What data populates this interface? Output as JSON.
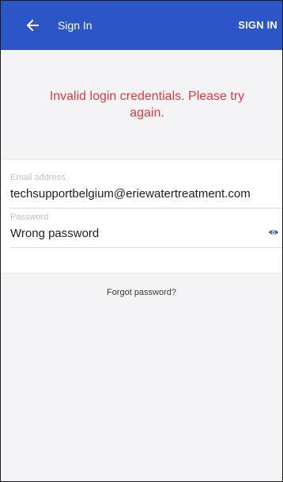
{
  "header": {
    "back_icon": "arrow-left-icon",
    "title": "Sign In",
    "action_label": "SIGN IN"
  },
  "error": {
    "message": "Invalid login credentials. Please try again."
  },
  "form": {
    "email": {
      "label": "Email address",
      "value": "techsupportbelgium@eriewatertreatment.com"
    },
    "password": {
      "label": "Password",
      "value": "Wrong password",
      "toggle_icon": "eye-icon"
    }
  },
  "links": {
    "forgot_password": "Forgot password?"
  },
  "colors": {
    "appbar": "#2c56c8",
    "error": "#e0393e",
    "background": "#f4f4f6"
  }
}
